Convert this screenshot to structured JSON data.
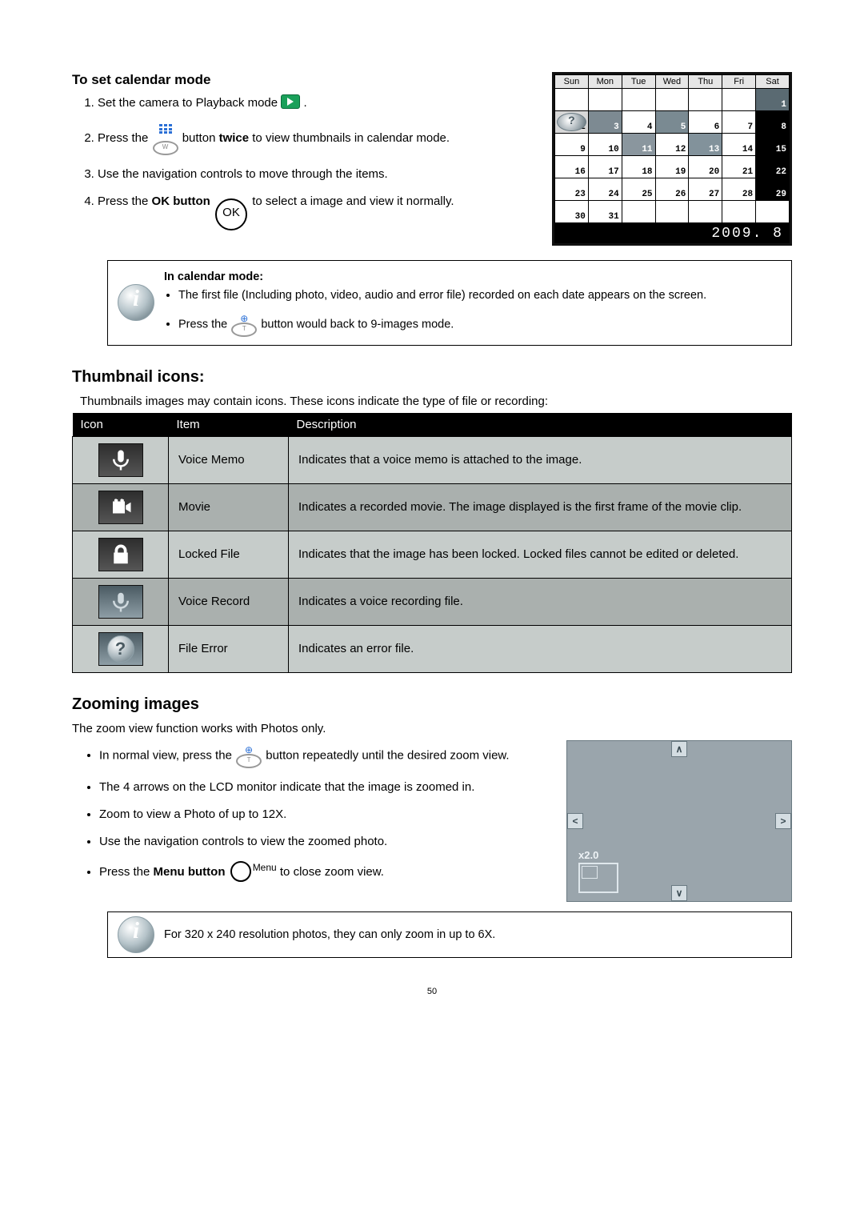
{
  "section1": {
    "heading": "To set calendar mode",
    "steps": {
      "s1_a": "Set the camera to Playback mode ",
      "s1_b": ".",
      "s2_a": "Press the ",
      "s2_b": " button ",
      "s2_bold": "twice",
      "s2_c": " to view thumbnails in calendar mode.",
      "s3": "Use the navigation controls to move through the items.",
      "s4_a": "Press the ",
      "s4_bold": "OK button",
      "s4_b": " ",
      "s4_c": " to select a image and view it normally.",
      "ok_label": "OK"
    }
  },
  "calendar": {
    "days": [
      "Sun",
      "Mon",
      "Tue",
      "Wed",
      "Thu",
      "Fri",
      "Sat"
    ],
    "rows": [
      [
        {
          "v": ""
        },
        {
          "v": ""
        },
        {
          "v": ""
        },
        {
          "v": ""
        },
        {
          "v": ""
        },
        {
          "v": ""
        },
        {
          "v": "1",
          "cls": "photo8"
        }
      ],
      [
        {
          "v": "2",
          "cls": "sel"
        },
        {
          "v": "3",
          "cls": "photo3"
        },
        {
          "v": "4"
        },
        {
          "v": "5",
          "cls": "photo5"
        },
        {
          "v": "6"
        },
        {
          "v": "7"
        },
        {
          "v": "8",
          "cls": "black"
        }
      ],
      [
        {
          "v": "9"
        },
        {
          "v": "10"
        },
        {
          "v": "11",
          "cls": "photo11"
        },
        {
          "v": "12"
        },
        {
          "v": "13",
          "cls": "photo13"
        },
        {
          "v": "14"
        },
        {
          "v": "15",
          "cls": "black"
        }
      ],
      [
        {
          "v": "16"
        },
        {
          "v": "17"
        },
        {
          "v": "18"
        },
        {
          "v": "19"
        },
        {
          "v": "20"
        },
        {
          "v": "21"
        },
        {
          "v": "22",
          "cls": "black"
        }
      ],
      [
        {
          "v": "23"
        },
        {
          "v": "24"
        },
        {
          "v": "25"
        },
        {
          "v": "26"
        },
        {
          "v": "27"
        },
        {
          "v": "28"
        },
        {
          "v": "29",
          "cls": "black"
        }
      ],
      [
        {
          "v": "30"
        },
        {
          "v": "31"
        },
        {
          "v": ""
        },
        {
          "v": ""
        },
        {
          "v": ""
        },
        {
          "v": ""
        },
        {
          "v": ""
        }
      ]
    ],
    "footer": "2009. 8"
  },
  "infobox1": {
    "heading": "In calendar mode:",
    "b1": "The first file (Including photo, video, audio and error file) recorded on each date appears on the screen.",
    "b2_a": "Press the ",
    "b2_b": " button would back to 9-images mode."
  },
  "section2": {
    "heading": "Thumbnail icons:",
    "intro": "Thumbnails images may contain icons. These icons indicate the type of file or recording:",
    "headers": {
      "icon": "Icon",
      "item": "Item",
      "desc": "Description"
    },
    "rows": [
      {
        "item": "Voice Memo",
        "desc": "Indicates that a voice memo is attached to the image."
      },
      {
        "item": "Movie",
        "desc": "Indicates a recorded movie. The image displayed is the first frame of the movie clip."
      },
      {
        "item": "Locked File",
        "desc": "Indicates that the image has been locked. Locked files cannot be edited or deleted."
      },
      {
        "item": "Voice Record",
        "desc": "Indicates a voice recording file."
      },
      {
        "item": "File Error",
        "desc": "Indicates an error file."
      }
    ]
  },
  "section3": {
    "heading": "Zooming images",
    "intro": "The zoom view function works with Photos only.",
    "b1_a": "In normal view, press the ",
    "b1_b": " button repeatedly until the desired zoom view.",
    "b2": "The 4 arrows on the LCD monitor indicate that the image is zoomed in.",
    "b3": "Zoom to view a Photo of up to 12X.",
    "b4": "Use the navigation controls to view the zoomed photo.",
    "b5_a": "Press the ",
    "b5_bold": "Menu button",
    "b5_b": " ",
    "b5_menu": "Menu",
    "b5_c": " to close zoom view.",
    "zoom_ratio": "x2.0"
  },
  "infobox2": {
    "text": "For 320 x 240 resolution photos, they can only zoom in up to 6X."
  },
  "page_number": "50"
}
